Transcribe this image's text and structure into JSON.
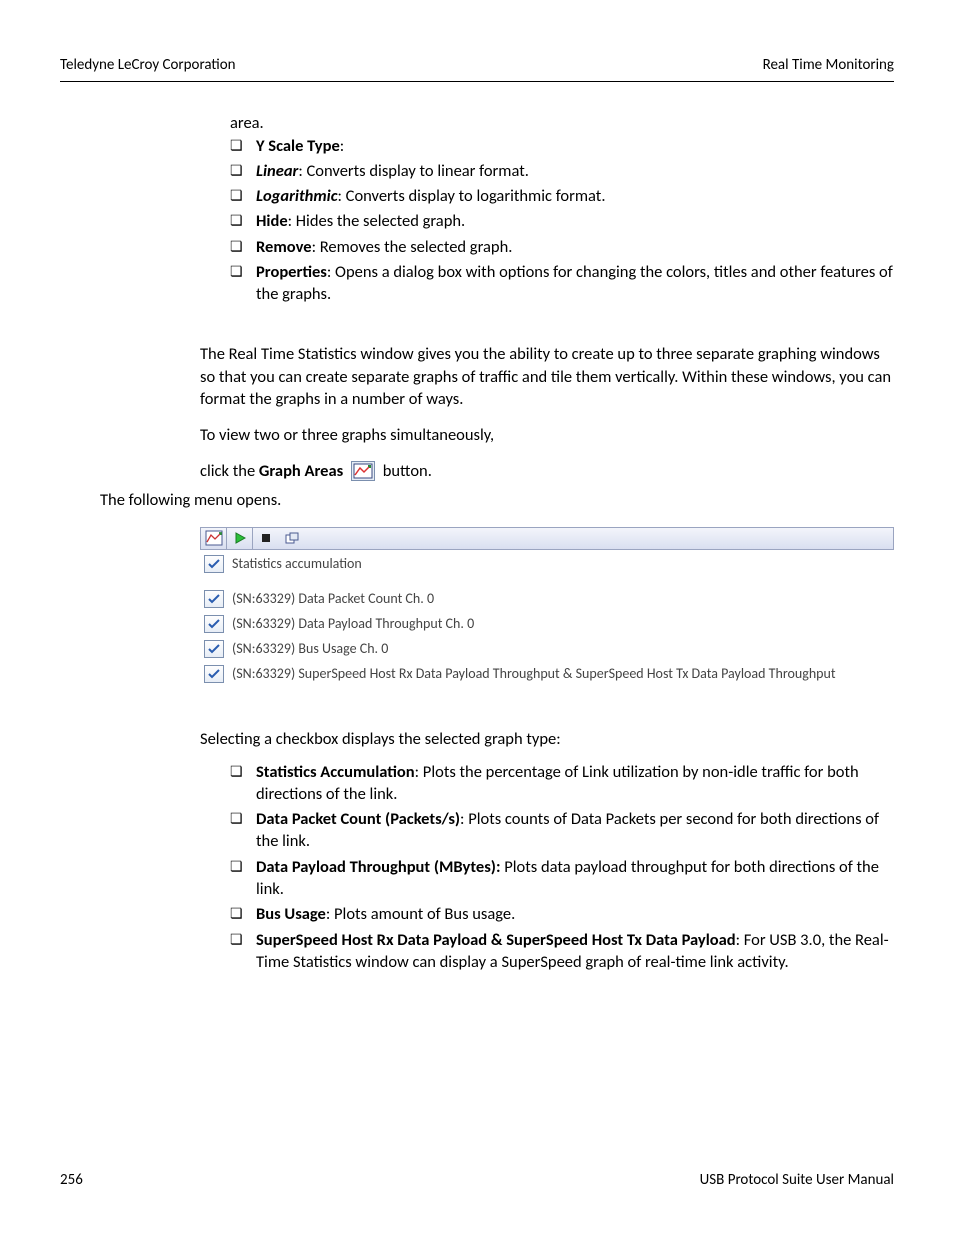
{
  "header": {
    "left": "Teledyne LeCroy Corporation",
    "right": "Real Time Monitoring"
  },
  "top": {
    "area": "area.",
    "items": [
      {
        "bold": "Y Scale Type",
        "rest": ":"
      },
      {
        "boldItalic": "Linear",
        "rest": ": Converts display to linear format."
      },
      {
        "boldItalic": "Logarithmic",
        "rest": ": Converts display to logarithmic format."
      },
      {
        "bold": "Hide",
        "rest": ": Hides the selected graph."
      },
      {
        "bold": "Remove",
        "rest": ": Removes the selected graph."
      },
      {
        "bold": "Properties",
        "rest": ": Opens a dialog box with options for changing the colors, titles and other features of the graphs."
      }
    ]
  },
  "mid": {
    "p1": "The Real Time Statistics window gives you the ability to create up to three separate graphing windows so that you can create separate graphs of traffic and tile them vertically. Within these windows, you can format the graphs in a number of ways.",
    "p2": "To view two or three graphs simultaneously,",
    "p3a": "click the ",
    "p3bold": "Graph Areas",
    "p3b": "  button.",
    "p4": "The following menu opens."
  },
  "menu": {
    "rows": [
      "Statistics accumulation",
      "(SN:63329) Data Packet Count Ch. 0",
      "(SN:63329) Data Payload Throughput Ch. 0",
      "(SN:63329) Bus Usage Ch. 0",
      "(SN:63329) SuperSpeed Host Rx Data Payload Throughput & SuperSpeed Host Tx Data Payload Throughput"
    ]
  },
  "after": {
    "lead": "Selecting a checkbox displays the selected graph type:",
    "items": [
      {
        "bold": "Statistics Accumulation",
        "rest": ": Plots the percentage of Link utilization by non-idle traffic for both directions of the link."
      },
      {
        "bold": "Data Packet Count (Packets/s)",
        "rest": ": Plots counts of Data Packets per second for both directions of the link."
      },
      {
        "bold": "Data Payload Throughput (MBytes):",
        "rest": " Plots data payload throughput for both directions of the link."
      },
      {
        "bold": "Bus Usage",
        "rest": ": Plots amount of Bus usage."
      },
      {
        "bold": "SuperSpeed Host Rx Data Payload & SuperSpeed Host Tx Data Payload",
        "rest": ": For USB 3.0, the Real-Time Statistics window can display a SuperSpeed graph of real-time link activity."
      }
    ]
  },
  "footer": {
    "page": "256",
    "title": "USB Protocol Suite User Manual"
  }
}
